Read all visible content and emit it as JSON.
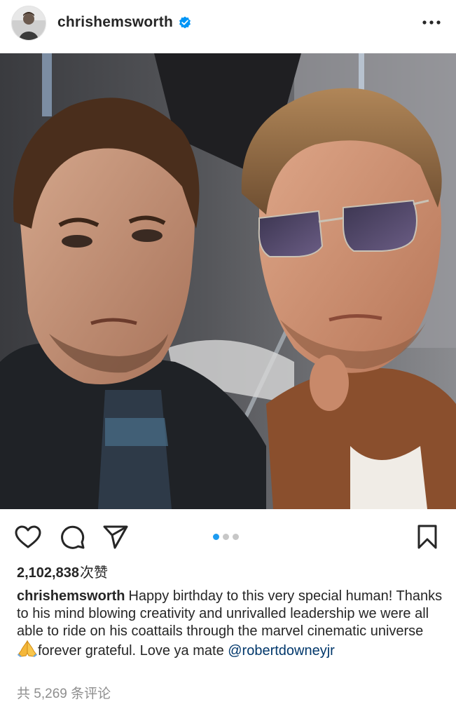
{
  "header": {
    "username": "chrishemsworth",
    "verified": true,
    "avatar_icon": "profile-avatar",
    "more_icon": "more-horizontal-icon"
  },
  "post": {
    "image_alt": "selfie-photo",
    "carousel": {
      "count": 3,
      "active": 1
    }
  },
  "actions": {
    "like_icon": "heart-icon",
    "comment_icon": "comment-icon",
    "share_icon": "share-icon",
    "save_icon": "bookmark-icon"
  },
  "likes": {
    "count": "2,102,838",
    "suffix": "次赞"
  },
  "caption": {
    "username": "chrishemsworth",
    "text_before_emoji": "Happy birthday to this very special human! Thanks to his mind blowing creativity and unrivalled leadership we were all able to ride on his coattails through the marvel cinematic universe",
    "emoji": "🙏",
    "text_after_emoji": "forever grateful.  Love ya mate ",
    "mention": "@robertdowneyjr"
  },
  "comments": {
    "text": "共 5,269 条评论"
  },
  "colors": {
    "text": "#262626",
    "muted": "#8e8e8e",
    "link": "#00376b",
    "verified": "#0095f6",
    "carousel_active": "#1d9bf0"
  }
}
